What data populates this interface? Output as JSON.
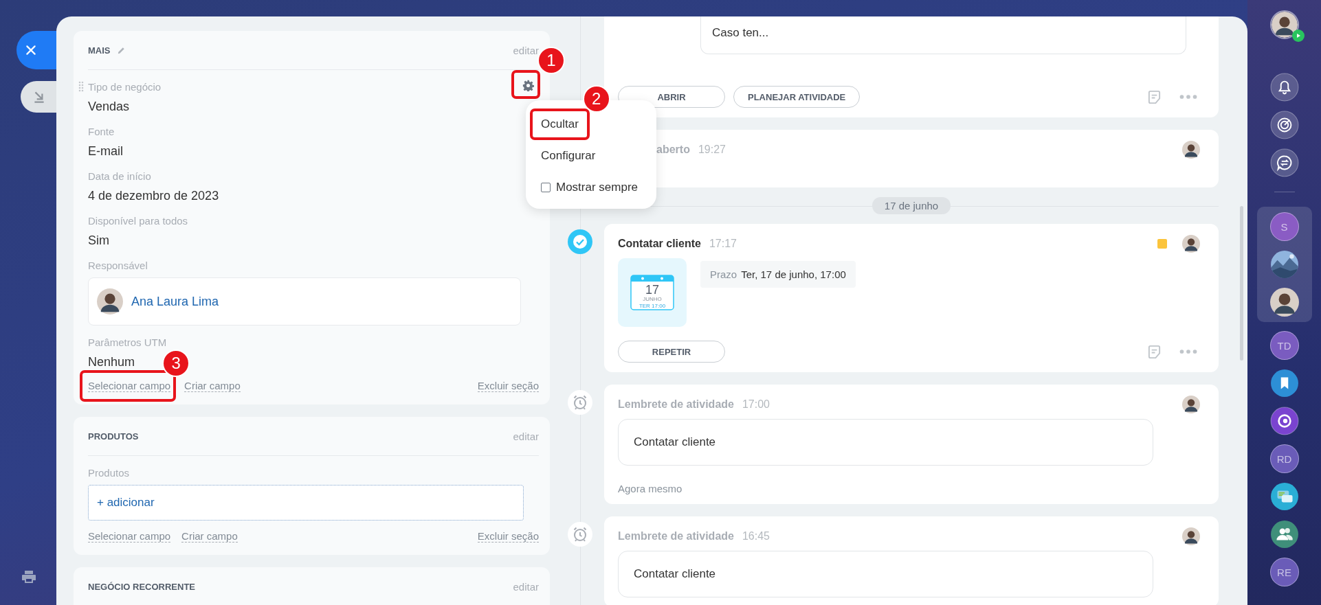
{
  "sections": [
    {
      "title": "MAIS",
      "title_editable": true,
      "edit_link": "editar",
      "fields": [
        {
          "label": "Tipo de negócio",
          "kind": "text",
          "value": "Vendas",
          "hovered": true,
          "settings_annotation": "1"
        },
        {
          "label": "Fonte",
          "kind": "text",
          "value": "E-mail",
          "hovered": false
        },
        {
          "label": "Data de início",
          "kind": "text",
          "value": "4 de dezembro de 2023",
          "hovered": false
        },
        {
          "label": "Disponível para todos",
          "kind": "text",
          "value": "Sim",
          "hovered": false
        },
        {
          "label": "Responsável",
          "kind": "person",
          "value": "Ana Laura Lima",
          "hovered": false
        },
        {
          "label": "Parâmetros UTM",
          "kind": "text",
          "value": "Nenhum",
          "hovered": false
        }
      ],
      "links": [
        {
          "label": "Selecionar campo",
          "annotation": "3"
        },
        {
          "label": "Criar campo"
        }
      ],
      "delete_link": "Excluir seção"
    },
    {
      "title": "PRODUTOS",
      "title_editable": false,
      "edit_link": "editar",
      "fields": [
        {
          "label": "Produtos",
          "kind": "add",
          "value": "+ adicionar",
          "hovered": false
        }
      ],
      "links": [
        {
          "label": "Selecionar campo"
        },
        {
          "label": "Criar campo"
        }
      ],
      "delete_link": "Excluir seção"
    },
    {
      "title": "NEGÓCIO RECORRENTE",
      "title_editable": false,
      "edit_link": "editar"
    }
  ],
  "field_menu": {
    "items": [
      {
        "kind": "item",
        "label": "Ocultar",
        "annotation": "2"
      },
      {
        "kind": "item",
        "label": "Configurar"
      },
      {
        "kind": "checkbox",
        "label": "Mostrar sempre",
        "checked": false
      }
    ]
  },
  "timeline": [
    {
      "kind": "email",
      "text": "Caso ten...",
      "buttons": [
        "ABRIR",
        "PLANEJAR ATIVIDADE"
      ]
    },
    {
      "kind": "event",
      "title": "aberto",
      "time": "19:27"
    },
    {
      "kind": "date",
      "label": "17 de junho"
    },
    {
      "kind": "task",
      "title": "Contatar cliente",
      "time": "17:17",
      "color": "#fbc43c",
      "calendar": {
        "day": "17",
        "month": "JUNHO",
        "weekday": "TER 17:00"
      },
      "deadline_label": "Prazo",
      "deadline": "Ter, 17 de junho, 17:00",
      "buttons": [
        "REPETIR"
      ]
    },
    {
      "kind": "reminder",
      "title": "Lembrete de atividade",
      "time": "17:00",
      "text": "Contatar cliente",
      "footer": "Agora mesmo"
    },
    {
      "kind": "reminder",
      "title": "Lembrete de atividade",
      "time": "16:45",
      "text": "Contatar cliente"
    }
  ],
  "right_bar": [
    {
      "kind": "user"
    },
    {
      "kind": "bell"
    },
    {
      "kind": "target"
    },
    {
      "kind": "sync-chat"
    },
    {
      "kind": "separator"
    },
    {
      "kind": "group",
      "items": [
        {
          "kind": "letters",
          "text": "S",
          "color": "#8a5cc4"
        },
        {
          "kind": "picture"
        },
        {
          "kind": "avatar"
        }
      ]
    },
    {
      "kind": "letters",
      "text": "TD",
      "color": "#7a5cc0"
    },
    {
      "kind": "bookmark"
    },
    {
      "kind": "copilot"
    },
    {
      "kind": "letters",
      "text": "RD",
      "color": "#6a5cb8"
    },
    {
      "kind": "chats"
    },
    {
      "kind": "people"
    },
    {
      "kind": "letters",
      "text": "RE",
      "color": "#6a5cb8"
    }
  ]
}
